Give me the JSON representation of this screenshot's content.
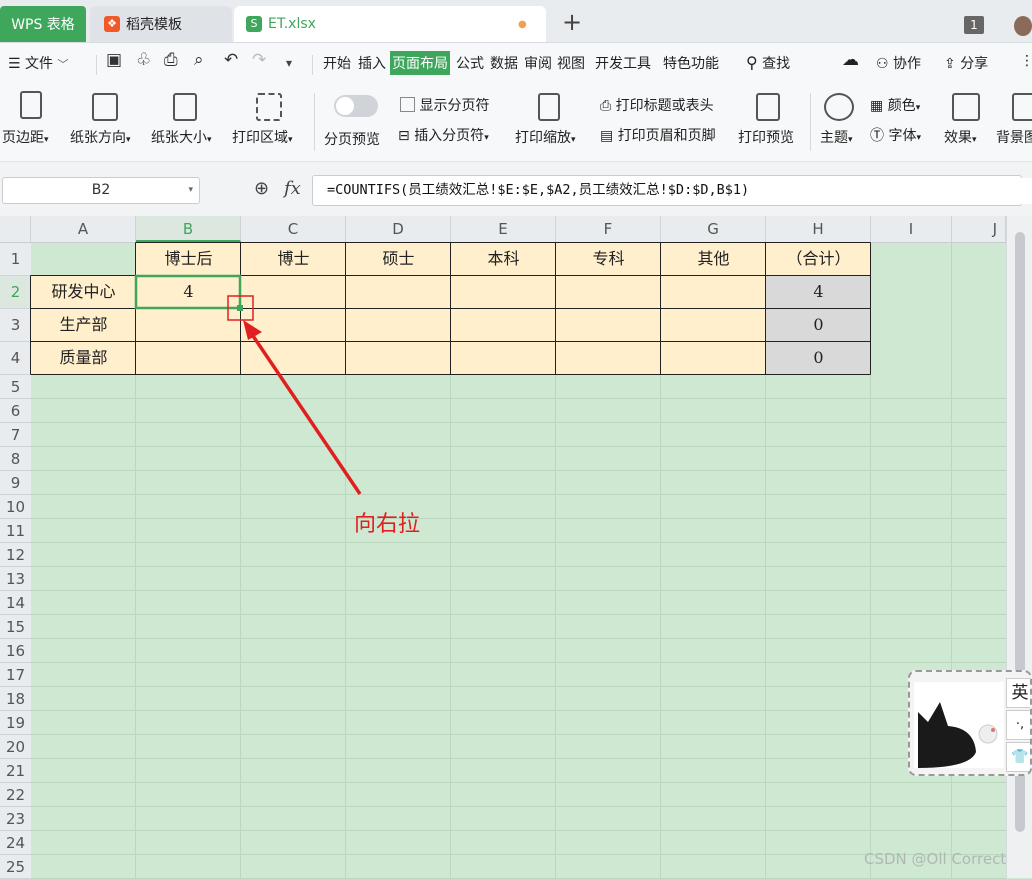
{
  "tabs": [
    {
      "label": "WPS 表格"
    },
    {
      "label": "稻壳模板"
    },
    {
      "label": "ET.xlsx",
      "modified_dot": "●"
    }
  ],
  "window": {
    "new_tab": "+",
    "badge": "1"
  },
  "menubar": {
    "file": "文件",
    "items": [
      "开始",
      "插入",
      "页面布局",
      "公式",
      "数据",
      "审阅",
      "视图",
      "开发工具",
      "特色功能"
    ],
    "active_item": "页面布局",
    "search": "查找",
    "collab": "协作",
    "share": "分享"
  },
  "ribbon": {
    "margins": "页边距",
    "orientation": "纸张方向",
    "size": "纸张大小",
    "print_area": "打印区域",
    "page_break_preview": "分页预览",
    "show_breaks": "显示分页符",
    "insert_break": "插入分页符",
    "print_scale": "打印缩放",
    "print_titles": "打印标题或表头",
    "header_footer": "打印页眉和页脚",
    "print_preview": "打印预览",
    "theme": "主题",
    "colors": "颜色",
    "fonts": "字体",
    "effects": "效果",
    "background": "背景图"
  },
  "formula_bar": {
    "name_box": "B2",
    "fx": "fx",
    "formula": "=COUNTIFS(员工绩效汇总!$E:$E,$A2,员工绩效汇总!$D:$D,B$1)"
  },
  "grid": {
    "columns": [
      "A",
      "B",
      "C",
      "D",
      "E",
      "F",
      "G",
      "H",
      "I",
      "J"
    ],
    "rows": [
      "1",
      "2",
      "3",
      "4",
      "5",
      "6",
      "7",
      "8",
      "9",
      "10",
      "11",
      "12",
      "13",
      "14",
      "15",
      "16",
      "17",
      "18",
      "19",
      "20",
      "21",
      "22",
      "23",
      "24",
      "25"
    ],
    "header_row": [
      "",
      "博士后",
      "博士",
      "硕士",
      "本科",
      "专科",
      "其他",
      "（合计）"
    ],
    "data_rows": [
      {
        "dept": "研发中心",
        "values": [
          "4",
          "",
          "",
          "",
          "",
          ""
        ],
        "total": "4"
      },
      {
        "dept": "生产部",
        "values": [
          "",
          "",
          "",
          "",
          "",
          ""
        ],
        "total": "0"
      },
      {
        "dept": "质量部",
        "values": [
          "",
          "",
          "",
          "",
          "",
          ""
        ],
        "total": "0"
      }
    ],
    "selected_cell": "B2"
  },
  "annotation": {
    "text": "向右拉"
  },
  "ime": {
    "lang": "英",
    "punct": "·,",
    "skin": "👕"
  },
  "watermark": "CSDN @Oll Correct",
  "colors": {
    "accent": "#3ea75b",
    "cell_fill": "#ffefcc",
    "total_fill": "#d9d9d9",
    "sheet_bg": "#cfe8d2",
    "annotation": "#e02020"
  }
}
